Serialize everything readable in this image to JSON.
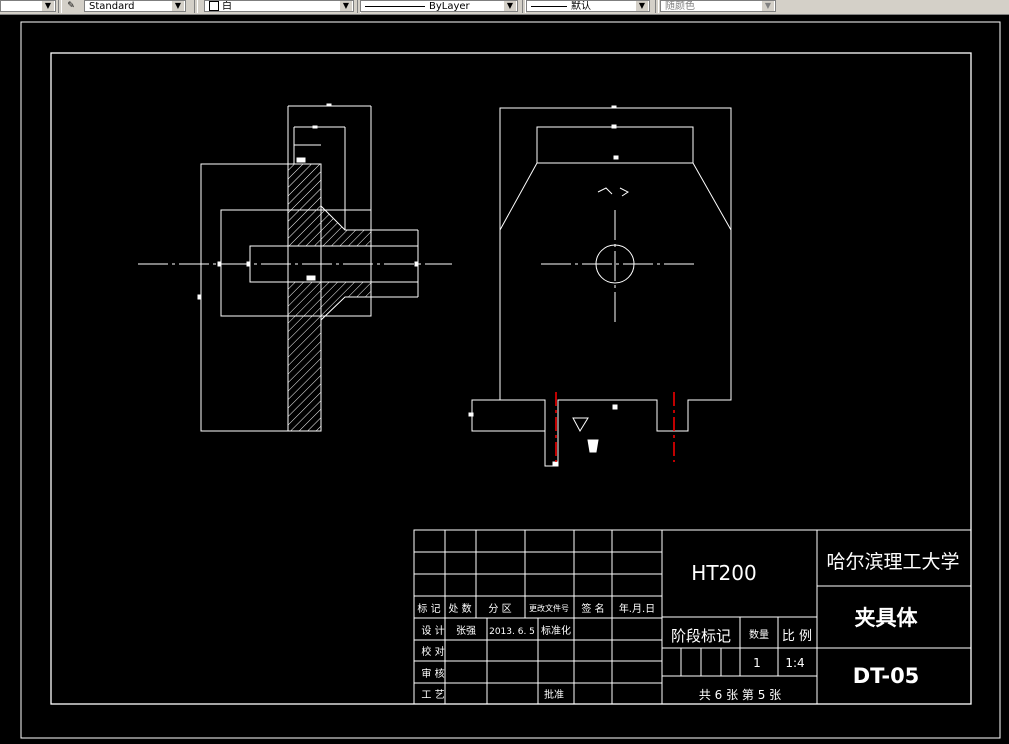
{
  "toolbar": {
    "dropdown_first_arrow": "▼",
    "textstyle_value": "Standard",
    "layer_value": "白",
    "linetype_value": "ByLayer",
    "lineweight_value": "默认",
    "plotstyle_value": "随颜色"
  },
  "colors": {
    "background": "#000000",
    "line": "#ffffff",
    "centerline_red": "#ff0000",
    "toolbar": "#d4d0c8"
  },
  "title_block": {
    "material": "HT200",
    "school": "哈尔滨理工大学",
    "part_name": "夹具体",
    "drawing_no": "DT-05",
    "stage_mark_label": "阶段标记",
    "quantity_label": "数量",
    "scale_label": "比 例",
    "quantity_value": "1",
    "scale_value": "1:4",
    "sheets": "共 6 张  第 5 张",
    "header": {
      "mark": "标 记",
      "count": "处 数",
      "zone": "分  区",
      "change_doc": "更改文件号",
      "signature": "签 名",
      "date": "年.月.日"
    },
    "rows": {
      "design": "设 计",
      "designer": "张强",
      "design_date": "2013. 6. 5",
      "standardize": "标准化",
      "proofread": "校 对",
      "review": "审 核",
      "process": "工 艺",
      "approve": "批准"
    }
  }
}
